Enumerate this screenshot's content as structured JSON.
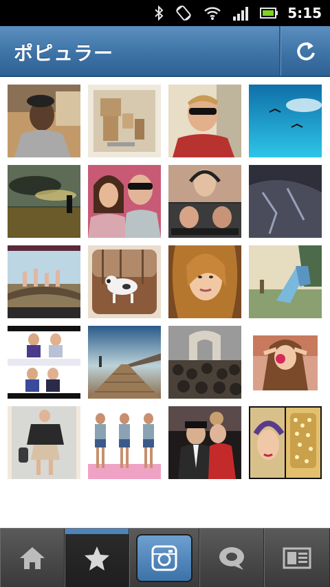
{
  "status_bar": {
    "time": "5:15",
    "icons": [
      "bluetooth-icon",
      "rotate-icon",
      "wifi-icon",
      "signal-icon",
      "battery-icon"
    ]
  },
  "header": {
    "title": "ポピュラー",
    "refresh_icon": "refresh-icon"
  },
  "photo_grid": {
    "columns": 4,
    "rows": 5,
    "items": [
      {
        "desc": "man-in-car"
      },
      {
        "desc": "cardboard-robot"
      },
      {
        "desc": "guy-sunglasses"
      },
      {
        "desc": "birds-sky"
      },
      {
        "desc": "sunset-field"
      },
      {
        "desc": "couple-selfie"
      },
      {
        "desc": "headphones-collage"
      },
      {
        "desc": "dark-shirt"
      },
      {
        "desc": "group-jumping"
      },
      {
        "desc": "dog-leaves"
      },
      {
        "desc": "girl-portrait"
      },
      {
        "desc": "park-slide"
      },
      {
        "desc": "duo-collage"
      },
      {
        "desc": "boardwalk"
      },
      {
        "desc": "crowd-arch"
      },
      {
        "desc": "girl-rose"
      },
      {
        "desc": "fashion-outfit"
      },
      {
        "desc": "girl-triptych"
      },
      {
        "desc": "couple-red-dress"
      },
      {
        "desc": "phone-case"
      }
    ]
  },
  "bottom_nav": {
    "items": [
      {
        "name": "home",
        "icon": "home-icon",
        "active": false
      },
      {
        "name": "popular",
        "icon": "star-icon",
        "active": true
      },
      {
        "name": "camera",
        "icon": "camera-icon",
        "active": false
      },
      {
        "name": "news",
        "icon": "speech-bubble-icon",
        "active": false
      },
      {
        "name": "profile",
        "icon": "profile-card-icon",
        "active": false
      }
    ]
  },
  "colors": {
    "header_blue": "#3e73a6",
    "nav_dark": "#3a3a3a",
    "active_bar": "#4c84bb"
  }
}
